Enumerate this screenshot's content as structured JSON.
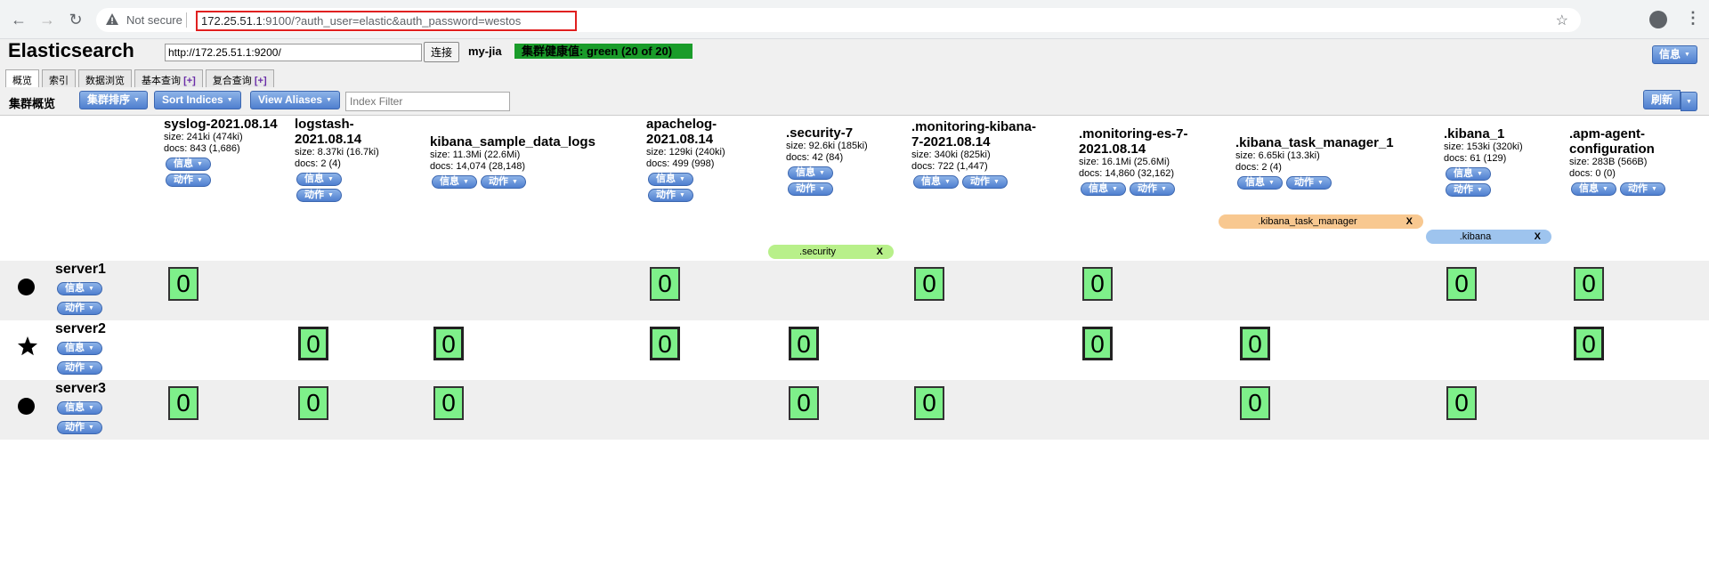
{
  "browser": {
    "security_label": "Not secure",
    "url_host": "172.25.51.1",
    "url_rest": ":9100/?auth_user=elastic&auth_password=westos"
  },
  "app": {
    "title": "Elasticsearch",
    "connect_url": "http://172.25.51.1:9200/",
    "connect_button": "连接",
    "cluster_name": "my-jia",
    "health": "集群健康值: green (20 of 20)",
    "info_button": "信息"
  },
  "tabs": [
    {
      "label": "概览",
      "plus": ""
    },
    {
      "label": "索引",
      "plus": ""
    },
    {
      "label": "数据浏览",
      "plus": ""
    },
    {
      "label": "基本查询",
      "plus": "[+]"
    },
    {
      "label": "复合查询",
      "plus": "[+]"
    }
  ],
  "toolbar": {
    "label": "集群概览",
    "sort_cluster": "集群排序",
    "sort_indices": "Sort Indices",
    "view_aliases": "View Aliases",
    "index_filter_placeholder": "Index Filter",
    "refresh": "刷新"
  },
  "buttons": {
    "info": "信息",
    "action": "动作"
  },
  "indices": [
    {
      "name": "syslog-2021.08.14",
      "size": "size: 241ki (474ki)",
      "docs": "docs: 843 (1,686)"
    },
    {
      "name": "logstash-2021.08.14",
      "size": "size: 8.37ki (16.7ki)",
      "docs": "docs: 2 (4)"
    },
    {
      "name": "kibana_sample_data_logs",
      "size": "size: 11.3Mi (22.6Mi)",
      "docs": "docs: 14,074 (28,148)"
    },
    {
      "name": "apachelog-2021.08.14",
      "size": "size: 129ki (240ki)",
      "docs": "docs: 499 (998)"
    },
    {
      "name": ".security-7",
      "size": "size: 92.6ki (185ki)",
      "docs": "docs: 42 (84)"
    },
    {
      "name": ".monitoring-kibana-7-2021.08.14",
      "size": "size: 340ki (825ki)",
      "docs": "docs: 722 (1,447)"
    },
    {
      "name": ".monitoring-es-7-2021.08.14",
      "size": "size: 16.1Mi (25.6Mi)",
      "docs": "docs: 14,860 (32,162)"
    },
    {
      "name": ".kibana_task_manager_1",
      "size": "size: 6.65ki (13.3ki)",
      "docs": "docs: 2 (4)"
    },
    {
      "name": ".kibana_1",
      "size": "size: 153ki (320ki)",
      "docs": "docs: 61 (129)"
    },
    {
      "name": ".apm-agent-configuration",
      "size": "size: 283B (566B)",
      "docs": "docs: 0 (0)"
    }
  ],
  "aliases": [
    {
      "label": ".security",
      "close": "X",
      "color": "#b8f08a"
    },
    {
      "label": ".kibana_task_manager",
      "close": "X",
      "color": "#f8c890"
    },
    {
      "label": ".kibana",
      "close": "X",
      "color": "#9ec4ee"
    }
  ],
  "nodes": [
    {
      "name": "server1",
      "marker": "dot",
      "shards": [
        {
          "col": 0,
          "value": "0"
        },
        {
          "col": 3,
          "value": "0"
        },
        {
          "col": 5,
          "value": "0"
        },
        {
          "col": 6,
          "value": "0"
        },
        {
          "col": 8,
          "value": "0"
        },
        {
          "col": 9,
          "value": "0"
        }
      ]
    },
    {
      "name": "server2",
      "marker": "star",
      "shards": [
        {
          "col": 1,
          "value": "0"
        },
        {
          "col": 2,
          "value": "0"
        },
        {
          "col": 3,
          "value": "0"
        },
        {
          "col": 4,
          "value": "0"
        },
        {
          "col": 6,
          "value": "0"
        },
        {
          "col": 7,
          "value": "0"
        },
        {
          "col": 9,
          "value": "0"
        }
      ]
    },
    {
      "name": "server3",
      "marker": "dot",
      "shards": [
        {
          "col": 0,
          "value": "0"
        },
        {
          "col": 1,
          "value": "0"
        },
        {
          "col": 2,
          "value": "0"
        },
        {
          "col": 4,
          "value": "0"
        },
        {
          "col": 5,
          "value": "0"
        },
        {
          "col": 7,
          "value": "0"
        },
        {
          "col": 8,
          "value": "0"
        }
      ]
    }
  ]
}
